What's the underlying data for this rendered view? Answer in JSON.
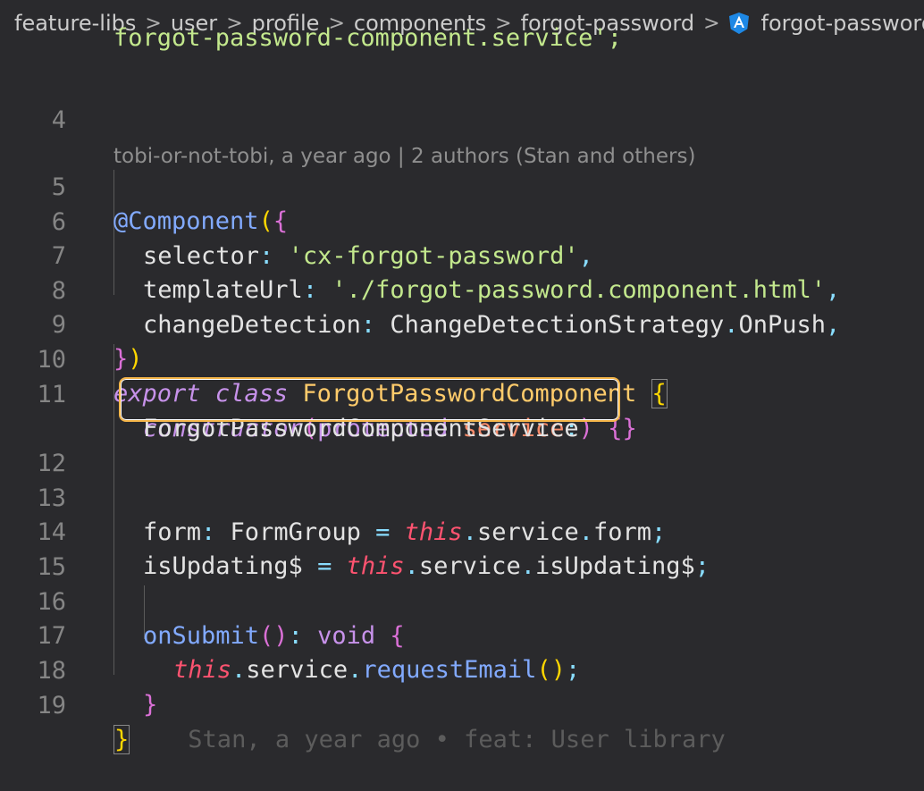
{
  "breadcrumb": {
    "items": [
      "feature-libs",
      "user",
      "profile",
      "components",
      "forgot-password",
      "forgot-password.c"
    ],
    "file_icon": "angular-icon"
  },
  "codelens": "tobi-or-not-tobi, a year ago | 2 authors (Stan and others)",
  "lines": {
    "l3_text": "forgot-password-component.service",
    "l3_end": "';",
    "l4": "4",
    "l5": "5",
    "l6": "6",
    "l7": "7",
    "l8": "8",
    "l9": "9",
    "l10": "10",
    "l11": "11",
    "l12": "12",
    "l13": "13",
    "l14": "14",
    "l15": "15",
    "l16": "16",
    "l17": "17",
    "l18": "18",
    "l19": "19"
  },
  "code": {
    "decorator": "@Component",
    "selector_key": "selector",
    "selector_val": "'cx-forgot-password'",
    "template_key": "templateUrl",
    "template_val": "'./forgot-password.component.html'",
    "cd_key": "changeDetection",
    "cd_class": "ChangeDetectionStrategy",
    "cd_member": "OnPush",
    "export_kw": "export",
    "class_kw": "class",
    "class_name": "ForgotPasswordComponent",
    "constructor_kw": "constructor",
    "protected_kw": "protected",
    "service_param": "service",
    "service_type": "ForgotPasswordComponentService",
    "form_key": "form",
    "form_type": "FormGroup",
    "this_kw": "this",
    "service_word": "service",
    "form_word": "form",
    "updating_key": "isUpdating$",
    "updating_word": "isUpdating$",
    "onsubmit": "onSubmit",
    "void_kw": "void",
    "request_fn": "requestEmail"
  },
  "inline_blame": "Stan, a year ago • feat: User library",
  "colors": {
    "highlight_border": "#f5b64a",
    "background": "#2a2a2d"
  }
}
